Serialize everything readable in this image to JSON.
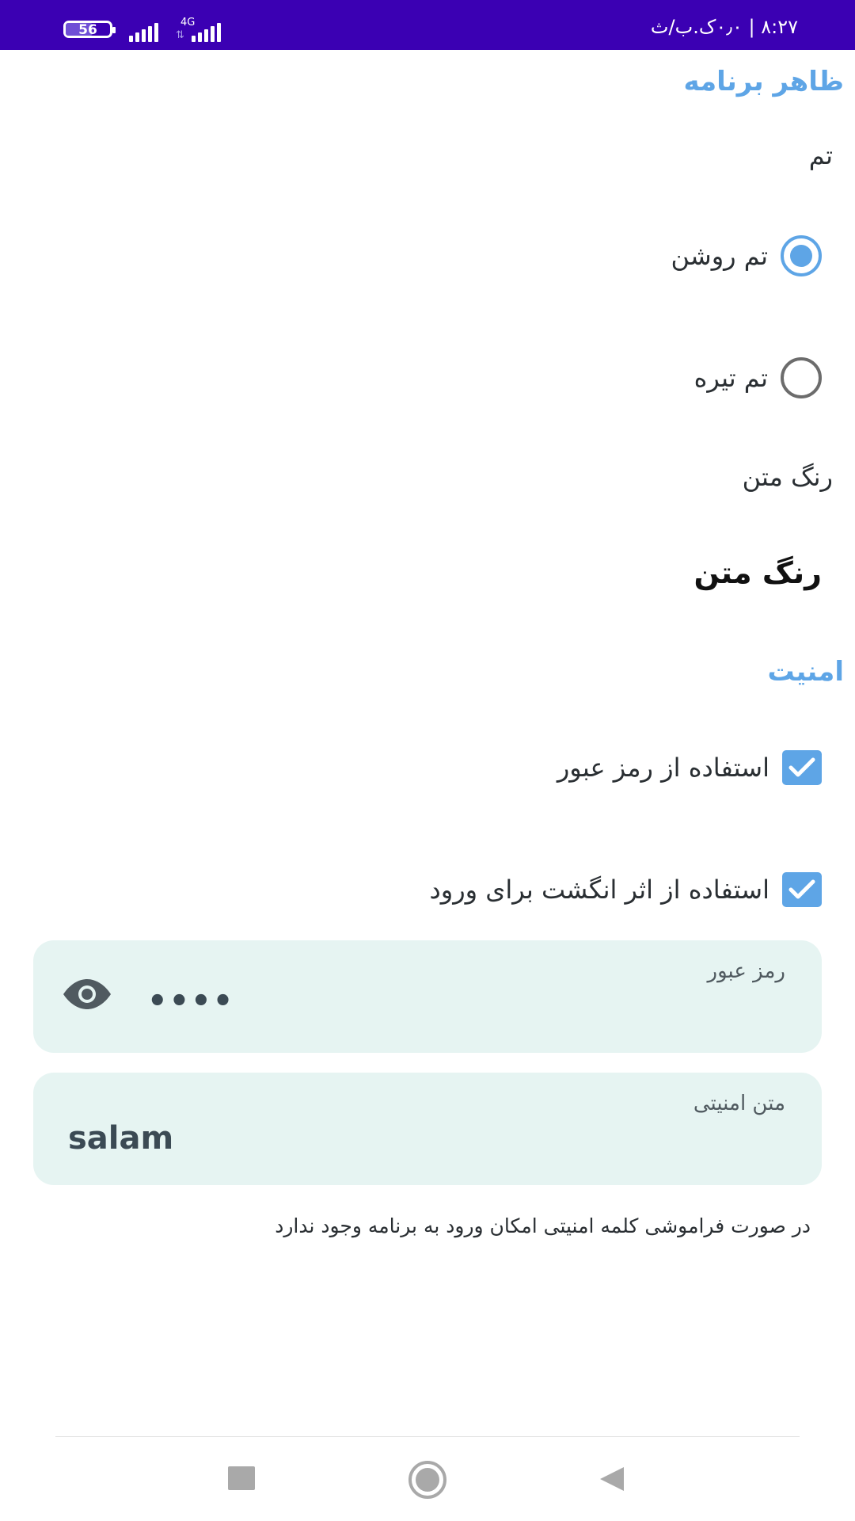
{
  "status_bar": {
    "time": "۸:۲۷ | ۰٫۰ک.ب/ث",
    "battery": "56",
    "battery_fraction": 0.6,
    "network": "4G",
    "network_arrows": "⇅"
  },
  "appearance": {
    "title": "ظاهر برنامه",
    "theme_label": "تم",
    "themes": [
      {
        "label": "تم روشن",
        "selected": true
      },
      {
        "label": "تم تیره",
        "selected": false
      }
    ],
    "text_color_label": "رنگ متن",
    "text_color_value": "رنگ متن"
  },
  "security": {
    "title": "امنیت",
    "use_password": {
      "label": "استفاده از رمز عبور",
      "checked": true
    },
    "use_fingerprint": {
      "label": "استفاده از اثر انگشت برای ورود",
      "checked": true
    },
    "password_field": {
      "label": "رمز عبور",
      "value": "••••"
    },
    "security_text_field": {
      "label": "متن امنیتی",
      "value": "salam"
    },
    "note": "در صورت فراموشی کلمه امنیتی امکان ورود به برنامه وجود ندارد"
  },
  "colors": {
    "status_bar": "#3b00b3",
    "accent": "#5ea5e6",
    "field_background": "#e6f4f2"
  },
  "icons": {
    "eye": "eye-icon",
    "check": "check-icon",
    "nav_recents": "square-icon",
    "nav_home": "circle-icon",
    "nav_back": "triangle-back-icon"
  }
}
